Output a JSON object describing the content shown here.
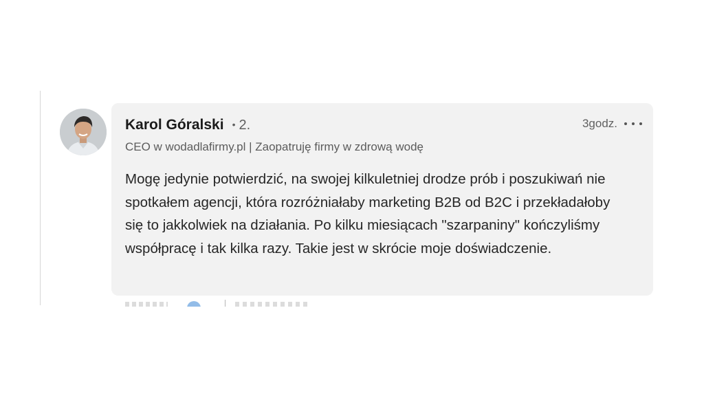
{
  "comment": {
    "author": "Karol Góralski",
    "degree_separator": "•",
    "degree": "2.",
    "headline": "CEO w wodadlafirmy.pl | Zaopatruję firmy w zdrową wodę",
    "timestamp": "3godz.",
    "more_icon": "more-horizontal-icon",
    "avatar_icon": "profile-photo",
    "text": "Mogę jedynie potwierdzić, na swojej kilkuletniej drodze prób i poszukiwań nie spotkałem agencji, która rozróżniałaby marketing B2B od B2C i przekładałoby się to jakkolwiek na działania. Po kilku miesiącach \"szarpaniny\" kończyliśmy współpracę i tak kilka razy. Takie jest w skrócie moje doświadczenie."
  },
  "colors": {
    "bubble_background": "#f2f2f2",
    "text_primary": "#262626",
    "text_secondary": "#5c5c5c"
  }
}
